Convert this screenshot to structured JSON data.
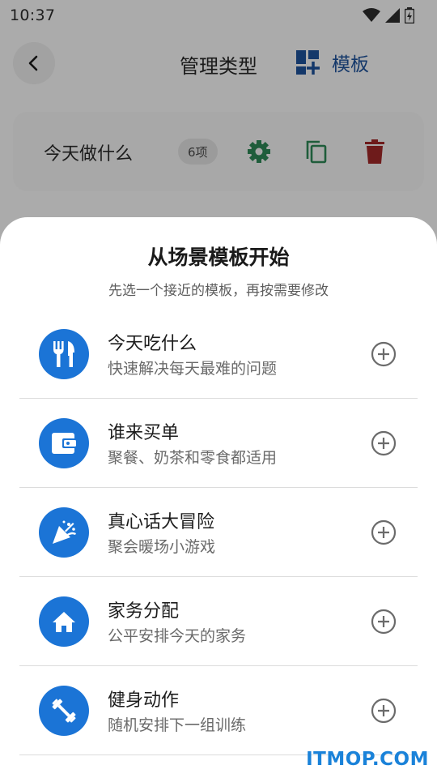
{
  "status_bar": {
    "time": "10:37",
    "icons": [
      "wifi-icon",
      "signal-icon",
      "battery-icon"
    ]
  },
  "app_bar": {
    "back_icon": "chevron-left-icon",
    "title": "管理类型",
    "template_icon": "dashboard-add-icon",
    "template_label": "模板"
  },
  "type_card": {
    "name": "今天做什么",
    "count": "6项",
    "actions": [
      "gear-icon",
      "copy-icon",
      "trash-icon"
    ]
  },
  "sheet": {
    "title": "从场景模板开始",
    "subtitle": "先选一个接近的模板，再按需要修改",
    "items": [
      {
        "icon": "utensils-icon",
        "title": "今天吃什么",
        "desc": "快速解决每天最难的问题"
      },
      {
        "icon": "wallet-icon",
        "title": "谁来买单",
        "desc": "聚餐、奶茶和零食都适用"
      },
      {
        "icon": "party-popper-icon",
        "title": "真心话大冒险",
        "desc": "聚会暖场小游戏"
      },
      {
        "icon": "home-icon",
        "title": "家务分配",
        "desc": "公平安排今天的家务"
      },
      {
        "icon": "dumbbell-icon",
        "title": "健身动作",
        "desc": "随机安排下一组训练"
      }
    ]
  },
  "colors": {
    "accent": "#1b74d6",
    "settings_green": "#1f5d3b",
    "delete_red": "#6e1b1b"
  },
  "watermark": "ITMOP.COM"
}
